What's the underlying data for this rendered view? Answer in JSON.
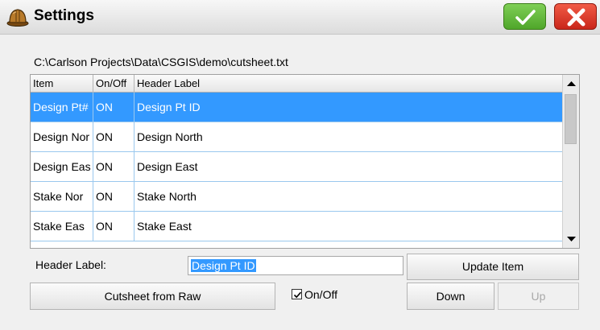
{
  "window": {
    "title": "Settings",
    "ok_icon": "check-icon",
    "close_icon": "x-icon",
    "app_icon": "hardhat-icon"
  },
  "file_path": "C:\\Carlson Projects\\Data\\CSGIS\\demo\\cutsheet.txt",
  "table": {
    "columns": [
      "Item",
      "On/Off",
      "Header Label"
    ],
    "rows": [
      {
        "item": "Design Pt#",
        "onoff": "ON",
        "label": "Design Pt ID",
        "selected": true
      },
      {
        "item": "Design Nor",
        "onoff": "ON",
        "label": "Design North",
        "selected": false
      },
      {
        "item": "Design Eas",
        "onoff": "ON",
        "label": "Design East",
        "selected": false
      },
      {
        "item": "Stake Nor",
        "onoff": "ON",
        "label": "Stake North",
        "selected": false
      },
      {
        "item": "Stake Eas",
        "onoff": "ON",
        "label": "Stake East",
        "selected": false
      }
    ]
  },
  "form": {
    "header_label_caption": "Header Label:",
    "header_label_value": "Design Pt ID",
    "update_button": "Update Item",
    "cutsheet_button": "Cutsheet from Raw",
    "onoff_checkbox": "On/Off",
    "onoff_checked": true,
    "down_button": "Down",
    "up_button": "Up"
  },
  "colors": {
    "selection": "#3399ff",
    "ok_green": "#5cb531",
    "close_red": "#d9301f"
  }
}
